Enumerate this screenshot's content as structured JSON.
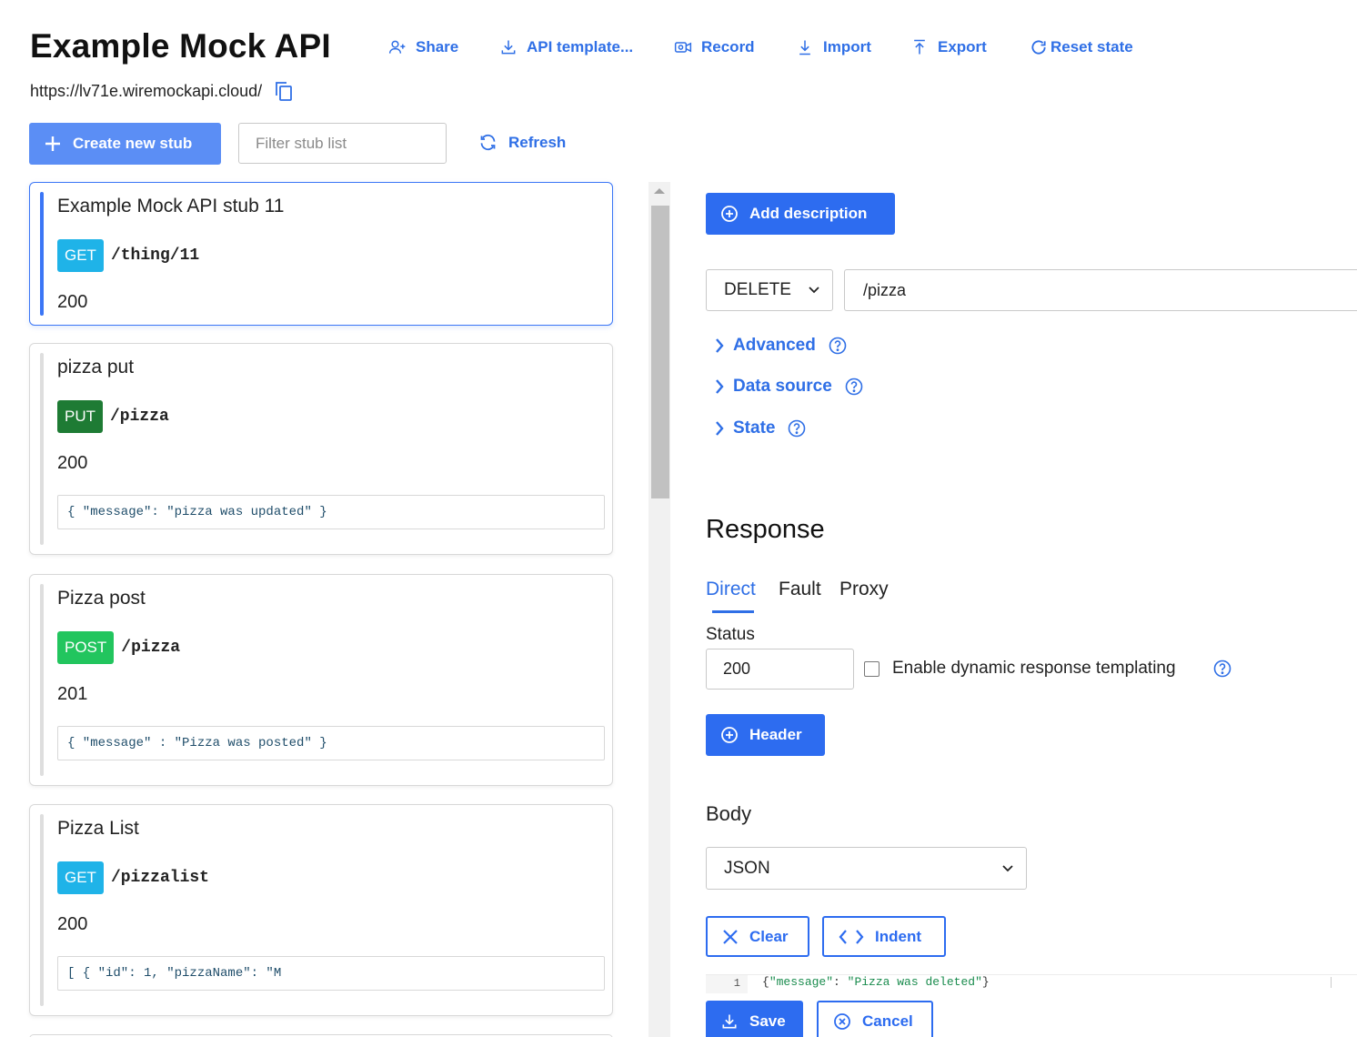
{
  "app": {
    "title": "Example Mock API",
    "base_url": "https://lv71e.wiremockapi.cloud/"
  },
  "toolbar": {
    "share": "Share",
    "api_template": "API template...",
    "record": "Record",
    "import": "Import",
    "export": "Export",
    "reset_state": "Reset state"
  },
  "actions": {
    "create_new_stub": "Create new stub",
    "filter_placeholder": "Filter stub list",
    "refresh": "Refresh"
  },
  "stubs": [
    {
      "name": "Example Mock API stub 11",
      "method": "GET",
      "path": "/thing/11",
      "status": "200",
      "body": ""
    },
    {
      "name": "pizza put",
      "method": "PUT",
      "path": "/pizza",
      "status": "200",
      "body": "{ \"message\": \"pizza was updated\" }"
    },
    {
      "name": "Pizza post",
      "method": "POST",
      "path": "/pizza",
      "status": "201",
      "body": "{ \"message\" : \"Pizza was posted\" }"
    },
    {
      "name": "Pizza List",
      "method": "GET",
      "path": "/pizzalist",
      "status": "200",
      "body": "[ { \"id\": 1, \"pizzaName\": \"M"
    }
  ],
  "editor": {
    "add_description": "Add description",
    "request": {
      "method": "DELETE",
      "url": "/pizza"
    },
    "sections": {
      "advanced": "Advanced",
      "data_source": "Data source",
      "state": "State"
    },
    "response": {
      "title": "Response",
      "tabs": {
        "direct": "Direct",
        "fault": "Fault",
        "proxy": "Proxy"
      },
      "active_tab": "Direct",
      "status_label": "Status",
      "status_value": "200",
      "templating_label": "Enable dynamic response templating",
      "templating_checked": false,
      "header_button": "Header",
      "body_label": "Body",
      "body_format": "JSON",
      "clear": "Clear",
      "indent": "Indent",
      "code": {
        "line_number": "1",
        "open": "{",
        "key": "\"message\"",
        "colon": ": ",
        "value": "\"Pizza was deleted\"",
        "close": "}"
      }
    },
    "save": "Save",
    "cancel": "Cancel"
  },
  "colors": {
    "accent": "#2f6fe6",
    "get": "#1fb3e8",
    "put": "#1e7b34",
    "post": "#22c55e"
  }
}
